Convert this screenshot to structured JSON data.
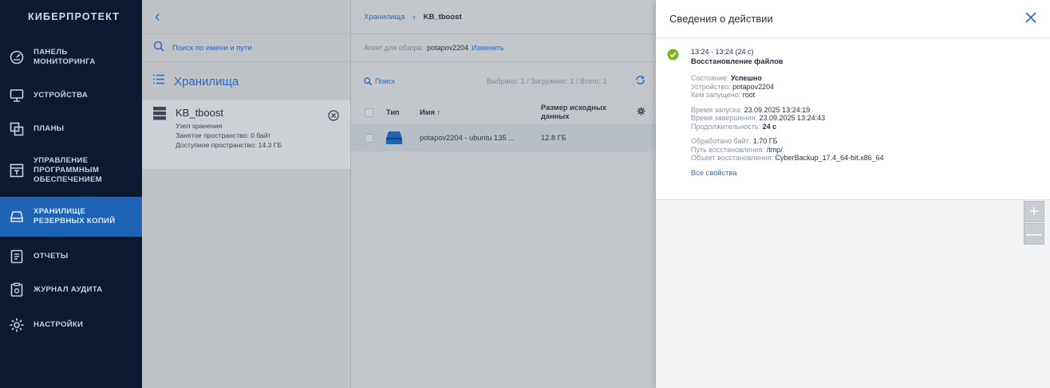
{
  "nav": {
    "brand": "КИБЕРПРОТЕКТ",
    "items": [
      {
        "label": "ПАНЕЛЬ\nМОНИТОРИНГА",
        "icon": "dashboard-icon"
      },
      {
        "label": "УСТРОЙСТВА",
        "icon": "monitor-icon"
      },
      {
        "label": "ПЛАНЫ",
        "icon": "plans-icon"
      },
      {
        "label": "УПРАВЛЕНИЕ\nПРОГРАММНЫМ\nОБЕСПЕЧЕНИЕМ",
        "icon": "software-icon"
      },
      {
        "label": "ХРАНИЛИЩЕ\nРЕЗЕРВНЫХ КОПИЙ",
        "icon": "storage-icon",
        "active": true
      },
      {
        "label": "ОТЧЕТЫ",
        "icon": "report-icon"
      },
      {
        "label": "ЖУРНАЛ АУДИТА",
        "icon": "audit-icon"
      },
      {
        "label": "НАСТРОЙКИ",
        "icon": "gear-icon"
      }
    ]
  },
  "storage_list": {
    "search_placeholder": "Поиск по имени и пути",
    "title": "Хранилища",
    "card": {
      "name": "KB_tboost",
      "type": "Узел хранения",
      "used": "Занятое пространство: 0 байт",
      "free": "Доступное пространство: 14.3 ГБ"
    }
  },
  "main": {
    "breadcrumb": {
      "root": "Хранилища",
      "sep": "›",
      "current": "KB_tboost"
    },
    "agent": {
      "label": "Агент для обзора:",
      "value": "potapov2204",
      "change": "Изменить"
    },
    "search": "Поиск",
    "counts": "Выбрано: 1 / Загружено: 1 / Всего: 1",
    "columns": {
      "type": "Тип",
      "name": "Имя ↑",
      "size": "Размер исходных\nданных"
    },
    "rows": [
      {
        "name": "potapov2204 - ubuntu 135 ...",
        "size": "12.8 ГБ"
      }
    ]
  },
  "panel": {
    "title": "Сведения о действии",
    "time": "13:24 - 13:24 (24 с)",
    "action": "Восстановление файлов",
    "state_k": "Состояние:",
    "state_v": "Успешно",
    "device_k": "Устройство:",
    "device_v": "potapov2204",
    "by_k": "Кем запущено:",
    "by_v": "root",
    "start_k": "Время запуска:",
    "start_v": "23.09.2025 13:24:19",
    "end_k": "Время завершения:",
    "end_v": "23.09.2025 13:24:43",
    "dur_k": "Продолжительность:",
    "dur_v": "24 с",
    "bytes_k": "Обработано байт:",
    "bytes_v": "1.70 ГБ",
    "path_k": "Путь восстановления:",
    "path_v": "/tmp/",
    "obj_k": "Объект восстановления:",
    "obj_v": "CyberBackup_17.4_64-bit.x86_64",
    "all_props": "Все свойства"
  },
  "zoom": {
    "plus": "+",
    "minus": "—"
  },
  "colors": {
    "nav_bg": "#0b1a33",
    "accent": "#2d69b8",
    "active": "#1d63b5",
    "success": "#7ab51d"
  }
}
